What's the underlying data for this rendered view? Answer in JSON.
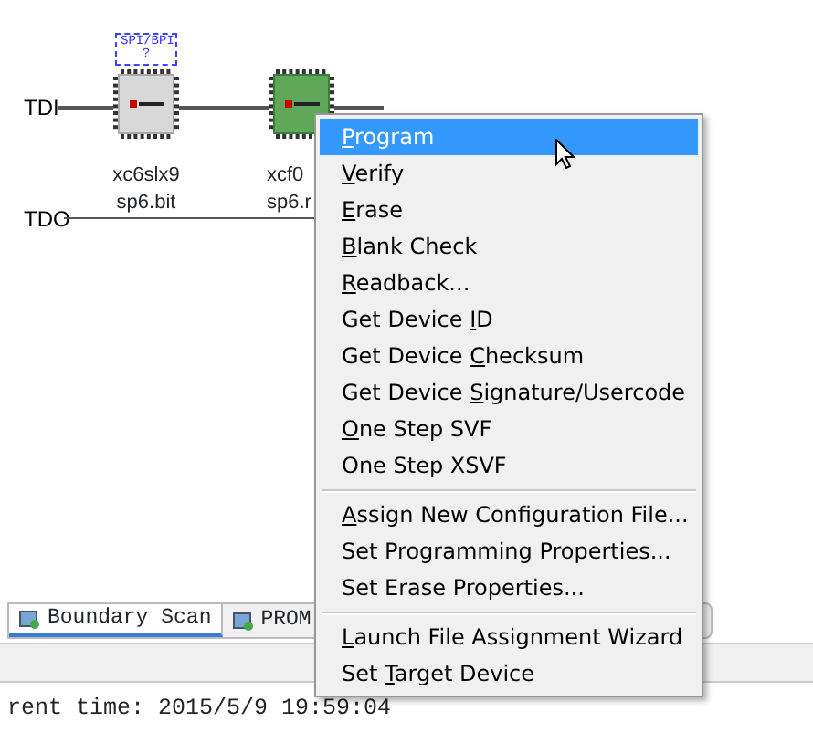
{
  "chain": {
    "tdi_label": "TDI",
    "tdo_label": "TDO",
    "devices": [
      {
        "kind": "fpga",
        "name": "xc6slx9",
        "file": "sp6.bit",
        "flash_label": "SPI/BPI",
        "flash_file": "?"
      },
      {
        "kind": "prom",
        "name": "xcf0",
        "file": "sp6.r"
      }
    ]
  },
  "context_menu": {
    "items": [
      {
        "kind": "item",
        "key": "P",
        "post": "rogram",
        "selected": true
      },
      {
        "kind": "item",
        "key": "V",
        "post": "erify",
        "selected": false
      },
      {
        "kind": "item",
        "key": "E",
        "post": "rase",
        "selected": false
      },
      {
        "kind": "item",
        "key": "B",
        "post": "lank Check",
        "selected": false
      },
      {
        "kind": "item",
        "key": "R",
        "post": "eadback...",
        "selected": false
      },
      {
        "kind": "item",
        "pre": "Get Device ",
        "key": "I",
        "post": "D",
        "selected": false
      },
      {
        "kind": "item",
        "pre": "Get Device ",
        "key": "C",
        "post": "hecksum",
        "selected": false
      },
      {
        "kind": "item",
        "pre": "Get Device ",
        "key": "S",
        "post": "ignature/Usercode",
        "selected": false
      },
      {
        "kind": "item",
        "key": "O",
        "post": "ne Step SVF",
        "selected": false
      },
      {
        "kind": "item",
        "pre": "One Step XSVF",
        "selected": false
      },
      {
        "kind": "separator"
      },
      {
        "kind": "item",
        "key": "A",
        "post": "ssign New Configuration File...",
        "selected": false
      },
      {
        "kind": "item",
        "pre": "Set Programming Properties...",
        "selected": false
      },
      {
        "kind": "item",
        "pre": "Set Erase Properties...",
        "selected": false
      },
      {
        "kind": "separator"
      },
      {
        "kind": "item",
        "key": "L",
        "post": "aunch File Assignment Wizard",
        "selected": false
      },
      {
        "kind": "item",
        "pre": "Set ",
        "key": "T",
        "post": "arget Device",
        "selected": false
      }
    ]
  },
  "tabs": [
    {
      "label": "Boundary Scan",
      "selected": true
    },
    {
      "label": "PROM",
      "selected": false
    }
  ],
  "console": {
    "lines": [
      "rent time: 2015/5/9 19:59:04"
    ]
  }
}
